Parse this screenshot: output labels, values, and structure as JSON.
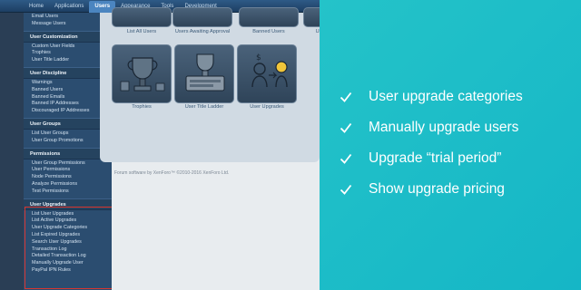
{
  "nav": {
    "tabs": [
      "Home",
      "Applications",
      "Users",
      "Appearance",
      "Tools",
      "Development"
    ],
    "active_index": 2
  },
  "sidebar": {
    "top_items": [
      "Email Users",
      "Message Users"
    ],
    "sections": [
      {
        "title": "User Customization",
        "items": [
          "Custom User Fields",
          "Trophies",
          "User Title Ladder"
        ]
      },
      {
        "title": "User Discipline",
        "items": [
          "Warnings",
          "Banned Users",
          "Banned Emails",
          "Banned IP Addresses",
          "Discouraged IP Addresses"
        ]
      },
      {
        "title": "User Groups",
        "items": [
          "List User Groups",
          "User Group Promotions"
        ]
      },
      {
        "title": "Permissions",
        "items": [
          "User Group Permissions",
          "User Permissions",
          "Node Permissions",
          "Analyze Permissions",
          "Test Permissions"
        ]
      },
      {
        "title": "User Upgrades",
        "items": [
          "List User Upgrades",
          "List Active Upgrades",
          "User Upgrade Categories",
          "List Expired Upgrades",
          "Search User Upgrades",
          "Transaction Log",
          "Detailed Transaction Log",
          "Manually Upgrade User",
          "PayPal IPN Rules"
        ]
      }
    ]
  },
  "main": {
    "top_tiles": [
      "List All Users",
      "Users Awaiting Approval",
      "Banned Users",
      "Us"
    ],
    "tiles": [
      {
        "label": "Trophies",
        "icon": "trophy-icon"
      },
      {
        "label": "User Title Ladder",
        "icon": "title-ladder-icon"
      },
      {
        "label": "User Upgrades",
        "icon": "user-upgrade-icon"
      }
    ],
    "footer": "Forum software by XenForo™ ©2010-2016 XenForo Ltd."
  },
  "features": [
    "User upgrade categories",
    "Manually upgrade users",
    "Upgrade “trial period”",
    "Show upgrade pricing"
  ],
  "colors": {
    "accent_teal": "#1bbcc8",
    "highlight_red": "#d9362f",
    "sidebar": "#2b4d70"
  }
}
